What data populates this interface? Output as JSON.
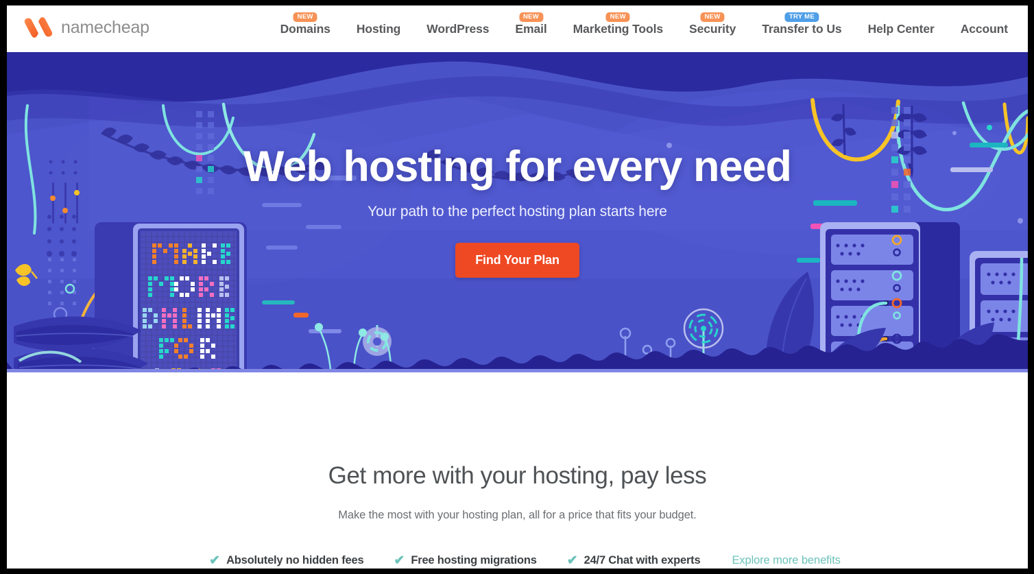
{
  "brand": {
    "name": "namecheap",
    "logo_icon": "namecheap-n-logo",
    "logo_color": "#f26322",
    "text_color": "#8d8d8d"
  },
  "nav": {
    "items": [
      {
        "label": "Domains",
        "badge": "NEW",
        "badge_type": "new"
      },
      {
        "label": "Hosting",
        "badge": null,
        "badge_type": null
      },
      {
        "label": "WordPress",
        "badge": null,
        "badge_type": null
      },
      {
        "label": "Email",
        "badge": "NEW",
        "badge_type": "new"
      },
      {
        "label": "Marketing Tools",
        "badge": "NEW",
        "badge_type": "new"
      },
      {
        "label": "Security",
        "badge": "NEW",
        "badge_type": "new"
      },
      {
        "label": "Transfer to Us",
        "badge": "TRY ME",
        "badge_type": "try"
      },
      {
        "label": "Help Center",
        "badge": null,
        "badge_type": null
      },
      {
        "label": "Account",
        "badge": null,
        "badge_type": null
      }
    ],
    "badge_colors": {
      "new": "#f79256",
      "try": "#4f9ee8"
    }
  },
  "hero": {
    "title": "Web hosting for every need",
    "subtitle": "Your path to the perfect hosting plan starts here",
    "cta_label": "Find Your Plan",
    "cta_color": "#ee4923",
    "background_color": "#4a52c8",
    "billboard_lines": [
      "MAKE",
      "MORE",
      "ONLINE",
      "FOR",
      "LESS"
    ],
    "illustration": "jungle-server-room"
  },
  "section": {
    "title": "Get more with your hosting, pay less",
    "subtitle": "Make the most with your hosting plan, all for a price that fits your budget.",
    "benefits": [
      {
        "label": "Absolutely no hidden fees"
      },
      {
        "label": "Free hosting migrations"
      },
      {
        "label": "24/7 Chat with experts"
      }
    ],
    "more_link": "Explore more benefits",
    "accent_color": "#6cc3bb"
  }
}
